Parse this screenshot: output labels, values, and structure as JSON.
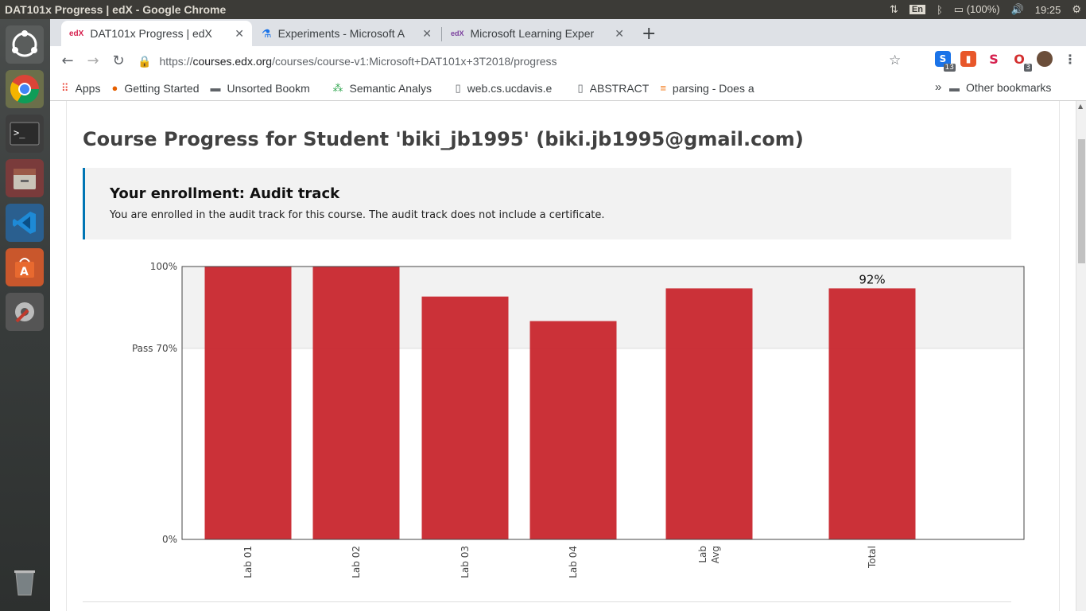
{
  "system": {
    "window_title": "DAT101x Progress | edX - Google Chrome",
    "lang": "En",
    "battery": "(100%)",
    "time": "19:25"
  },
  "tabs": [
    {
      "label": "DAT101x Progress | edX",
      "icon": "edx-icon",
      "active": true
    },
    {
      "label": "Experiments - Microsoft A",
      "icon": "flask-icon",
      "active": false
    },
    {
      "label": "Microsoft Learning Exper",
      "icon": "openedx-icon",
      "active": false
    }
  ],
  "newtab_label": "+",
  "address": {
    "scheme": "https://",
    "host": "courses.edx.org",
    "path": "/courses/course-v1:Microsoft+DAT101x+3T2018/progress"
  },
  "extensions": [
    {
      "name": "extension-s-icon",
      "badge": "13",
      "color": "#1a73e8",
      "glyph": "S"
    },
    {
      "name": "extension-office-icon",
      "badge": "",
      "color": "#e8572a",
      "glyph": "O"
    },
    {
      "name": "extension-scribd-icon",
      "badge": "",
      "color": "#ffffff",
      "glyph": "S"
    },
    {
      "name": "extension-red-icon",
      "badge": "3",
      "color": "#ffffff",
      "glyph": "O"
    }
  ],
  "bookmarks": [
    {
      "label": "Apps",
      "icon": "apps-grid-icon"
    },
    {
      "label": "Getting Started",
      "icon": "firefox-icon"
    },
    {
      "label": "Unsorted Bookm",
      "icon": "folder-icon"
    },
    {
      "label": "Semantic Analys",
      "icon": "people-icon"
    },
    {
      "label": "web.cs.ucdavis.e",
      "icon": "page-icon"
    },
    {
      "label": "ABSTRACT",
      "icon": "page-icon"
    },
    {
      "label": "parsing - Does a",
      "icon": "stackoverflow-icon"
    }
  ],
  "bookmarks_overflow": "»",
  "other_bookmarks": "Other bookmarks",
  "page": {
    "title": "Course Progress for Student 'biki_jb1995' (biki.jb1995@gmail.com)",
    "enrollment_title": "Your enrollment: Audit track",
    "enrollment_message": "You are enrolled in the audit track for this course. The audit track does not include a certificate."
  },
  "chart_data": {
    "type": "bar",
    "categories": [
      "Lab 01",
      "Lab 02",
      "Lab 03",
      "Lab 04",
      "Lab Avg",
      "Total"
    ],
    "values": [
      100,
      100,
      89,
      80,
      92,
      92
    ],
    "y_tick_labels": [
      "100%",
      "Pass 70%",
      "0%"
    ],
    "y_ticks": [
      100,
      70,
      0
    ],
    "ylim": [
      0,
      100
    ],
    "pass_threshold": 70,
    "annotations": [
      {
        "category": "Total",
        "text": "92%"
      }
    ],
    "bar_color": "#c8262d",
    "band_color": "#f2f2f2",
    "grid": false
  }
}
